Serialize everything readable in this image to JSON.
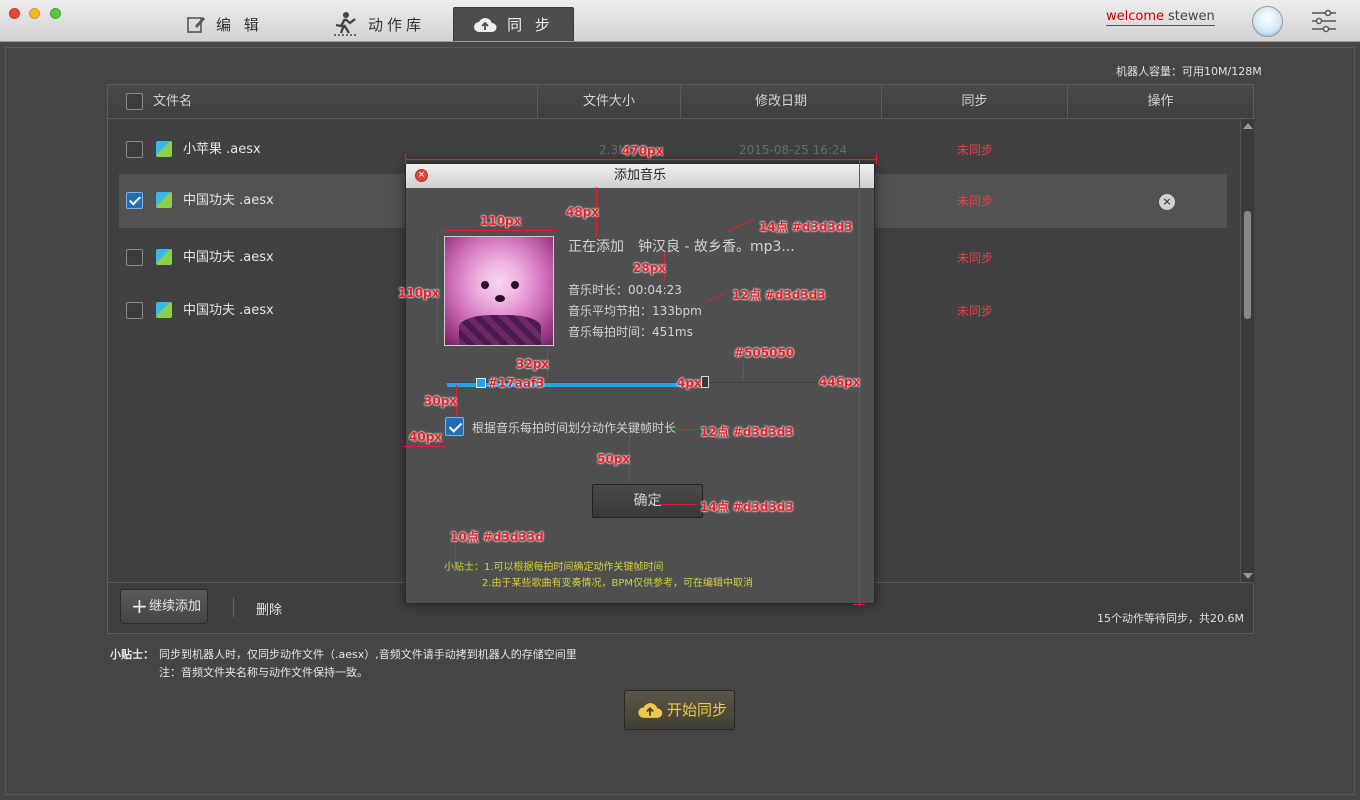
{
  "titlebar": {
    "tabs": [
      {
        "label": "编 辑"
      },
      {
        "label": "动作库"
      },
      {
        "label": "同 步"
      }
    ],
    "welcome": "welcome",
    "username": "stewen"
  },
  "header": {
    "capacity": "机器人容量：可用10M/128M"
  },
  "table": {
    "columns": [
      "文件名",
      "文件大小",
      "修改日期",
      "同步",
      "操作"
    ],
    "rows": [
      {
        "name": "小苹果 .aesx",
        "size": "2.3M",
        "date": "2015-08-25  16:24",
        "sync": "未同步",
        "checked": false
      },
      {
        "name": "中国功夫 .aesx",
        "size": "",
        "date": "",
        "sync": "未同步",
        "checked": true
      },
      {
        "name": "中国功夫 .aesx",
        "size": "",
        "date": "",
        "sync": "未同步",
        "checked": false
      },
      {
        "name": "中国功夫 .aesx",
        "size": "",
        "date": "",
        "sync": "未同步",
        "checked": false
      }
    ],
    "add_button": "继续添加",
    "delete_button": "删除",
    "pending": "15个动作等待同步，共20.6M"
  },
  "tips": {
    "label": "小贴士：",
    "line1": "同步到机器人时，仅同步动作文件（.aesx）,音频文件请手动拷到机器人的存储空间里",
    "line2": "注：音频文件夹名称与动作文件保持一致。"
  },
  "sync_button": "开始同步",
  "dialog": {
    "title": "添加音乐",
    "adding_prefix": "正在添加",
    "song": "钟汉良 - 故乡香。mp3...",
    "duration": "音乐时长：00:04:23",
    "bpm": "音乐平均节拍：133bpm",
    "beat": "音乐每拍时间：451ms",
    "progress": 0.59,
    "checkbox_label": "根据音乐每拍时间划分动作关键帧时长",
    "checkbox_checked": true,
    "ok": "确定",
    "tip1": "小贴士：1.可以根据每拍时间确定动作关键帧时间",
    "tip2": "2.由于某些歌曲有变奏情况，BPM仅供参考，可在编辑中取消"
  },
  "annotations": {
    "a470": "470px",
    "a110w": "110px",
    "a110h": "110px",
    "a48": "48px",
    "a28": "28px",
    "a32": "32px",
    "a30": "30px",
    "a40": "40px",
    "a50": "50px",
    "a4": "4px",
    "a446": "446px",
    "f14a": "14点 #d3d3d3",
    "f12a": "12点 #d3d3d3",
    "f12b": "12点 #d3d3d3",
    "f14b": "14点  #d3d3d3",
    "f10": "10点  #d3d33d",
    "c505050": "#505050",
    "c17aaf3": "#17aaf3"
  },
  "colors": {
    "accent": "#17aaf3",
    "track": "#505050",
    "text": "#d3d3d3",
    "unsynced": "#e8414a",
    "tip": "#d3d33d"
  }
}
